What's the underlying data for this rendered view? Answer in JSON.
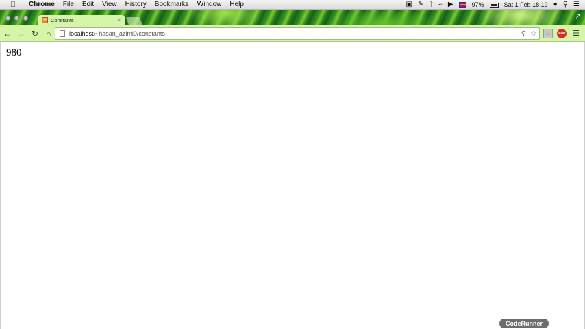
{
  "menubar": {
    "app": "Chrome",
    "items": [
      "File",
      "Edit",
      "View",
      "History",
      "Bookmarks",
      "Window",
      "Help"
    ],
    "battery": "97%",
    "datetime": "Sat 1 Feb  18:19"
  },
  "tab": {
    "title": "Constants"
  },
  "address": {
    "host": "localhost",
    "path": "/~hasan_azimi0/constants"
  },
  "page": {
    "output": "980"
  },
  "watermark": "CodeRunner",
  "theme": {
    "accent": "#d6f5a8",
    "tab_green": "#2f8f22"
  }
}
